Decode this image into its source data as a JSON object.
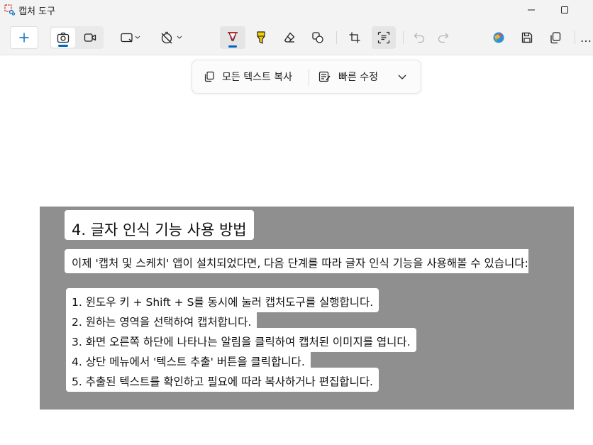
{
  "window": {
    "title": "캡처 도구"
  },
  "toolbar": {
    "new_icon": "plus-icon",
    "modes": [
      "camera-icon",
      "video-icon"
    ],
    "shape_icon": "rectangle-snip-icon",
    "delay_icon": "timer-off-icon",
    "tools": [
      "ballpoint-pen-icon",
      "highlighter-icon",
      "eraser-icon",
      "shapes-icon"
    ],
    "edit": [
      "crop-icon",
      "text-actions-icon"
    ],
    "history": [
      "undo-icon",
      "redo-icon"
    ],
    "output": [
      "paint3d-icon",
      "save-icon",
      "copy-icon",
      "more-icon"
    ],
    "more_label": "…"
  },
  "actions": {
    "copy_all_text": "모든 텍스트 복사",
    "quick_redact": "빠른 수정"
  },
  "capture": {
    "title": "4. 글자 인식 기능 사용 방법",
    "intro": "이제 '캡처 및 스케치' 앱이 설치되었다면, 다음 단계를 따라 글자 인식 기능을 사용해볼 수 있습니다:",
    "steps": [
      "1. 윈도우 키 + Shift + S를 동시에 눌러 캡처도구를 실행합니다.",
      "2. 원하는 영역을 선택하여 캡처합니다.",
      "3. 화면 오른쪽 하단에 나타나는 알림을 클릭하여 캡처된 이미지를 엽니다.",
      "4. 상단 메뉴에서 '텍스트 추출' 버튼을 클릭합니다.",
      "5. 추출된 텍스트를 확인하고 필요에 따라 복사하거나 편집합니다."
    ]
  },
  "colors": {
    "accent": "#0067c0",
    "pen_red": "#c4262e",
    "highlighter_yellow": "#f5d000",
    "capture_bg": "#8f8f8f"
  }
}
